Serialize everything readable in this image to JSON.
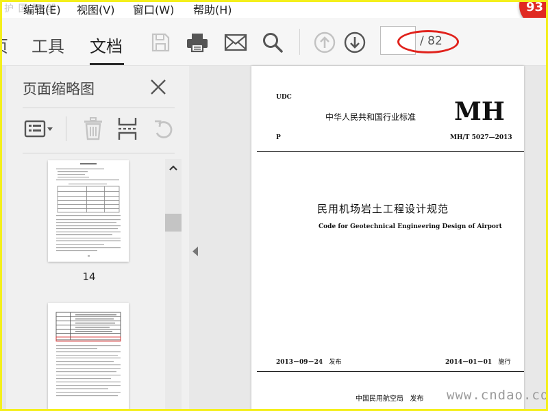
{
  "menu": {
    "ghost_text": "护 国 阿 部",
    "items": [
      "编辑(E)",
      "视图(V)",
      "窗口(W)",
      "帮助(H)"
    ]
  },
  "badge": {
    "text": "93",
    "color": "#e02a22"
  },
  "toolbar": {
    "tabs": [
      "页",
      "工具",
      "文档"
    ],
    "active_tab": "文档",
    "icons": [
      "save-icon",
      "print-icon",
      "mail-icon",
      "search-icon",
      "prev-page-icon",
      "next-page-icon"
    ],
    "page_number_value": "",
    "page_total": "/ 82"
  },
  "sidebar": {
    "title": "页面缩略图",
    "tool_icons": [
      "page-options-icon",
      "delete-icon",
      "extract-icon",
      "rotate-icon"
    ],
    "thumbnails": [
      {
        "label": "14"
      },
      {
        "label": ""
      }
    ]
  },
  "document": {
    "udc": "UDC",
    "standard_type": "中华人民共和国行业标准",
    "logo": "MH",
    "class": "P",
    "code": "MH/T 5027—2013",
    "title_cn": "民用机场岩土工程设计规范",
    "title_en": "Code for Geotechnical Engineering Design of Airport",
    "publish_date": "2013－09－24",
    "publish_label": "发布",
    "effective_date": "2014－01－01",
    "effective_label": "施行",
    "issuer": "中国民用航空局",
    "issuer_label": "发布"
  },
  "watermark": "www.cndao.com",
  "colors": {
    "highlight": "#e0221c",
    "frame": "#f4ef1c",
    "toolbar_bg": "#f6f6f6",
    "sidebar_bg": "#f0f0f0"
  }
}
